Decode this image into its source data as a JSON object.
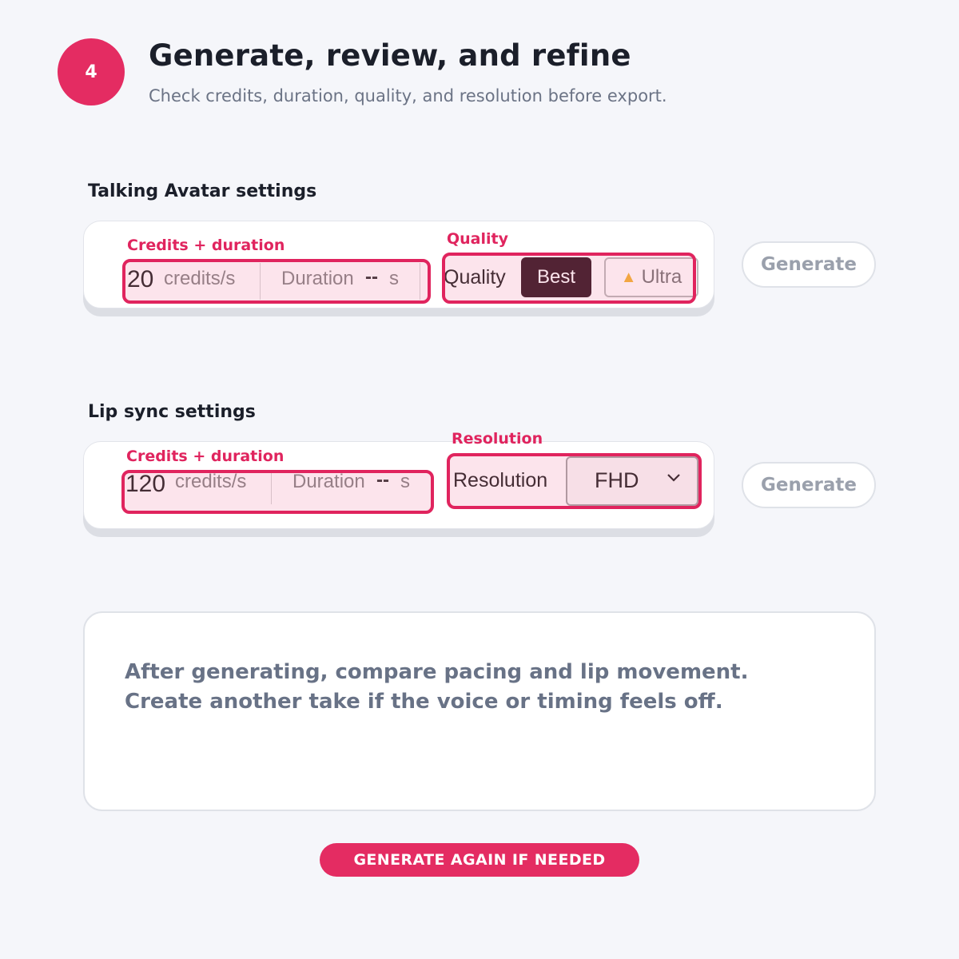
{
  "step": {
    "number": "4"
  },
  "header": {
    "title": "Generate, review, and refine",
    "subtitle": "Check credits, duration, quality, and resolution before export."
  },
  "talking_avatar": {
    "section_title": "Talking Avatar settings",
    "credits_value": "20",
    "credits_unit": "credits/s",
    "duration_label": "Duration",
    "duration_value": "--",
    "duration_unit": "s",
    "quality_label": "Quality",
    "quality_options": [
      "Best",
      "Ultra"
    ],
    "quality_selected": "Best",
    "annotations": {
      "credits": "Credits + duration",
      "quality": "Quality"
    },
    "generate_label": "Generate"
  },
  "lip_sync": {
    "section_title": "Lip sync settings",
    "credits_value": "120",
    "credits_unit": "credits/s",
    "duration_label": "Duration",
    "duration_value": "--",
    "duration_unit": "s",
    "resolution_label": "Resolution",
    "resolution_value": "FHD",
    "annotations": {
      "credits": "Credits + duration",
      "resolution": "Resolution"
    },
    "generate_label": "Generate"
  },
  "note": {
    "text": "After generating, compare pacing and lip movement. Create another take if the voice or timing feels off."
  },
  "cta": {
    "label": "GENERATE AGAIN IF NEEDED"
  },
  "icons": {
    "ultra": "crown-icon",
    "resolution_dropdown": "chevron-down-icon"
  },
  "colors": {
    "accent": "#e42c62",
    "annotation": "#e0245e",
    "best_button": "#3a1f29",
    "background": "#f5f6fa"
  }
}
